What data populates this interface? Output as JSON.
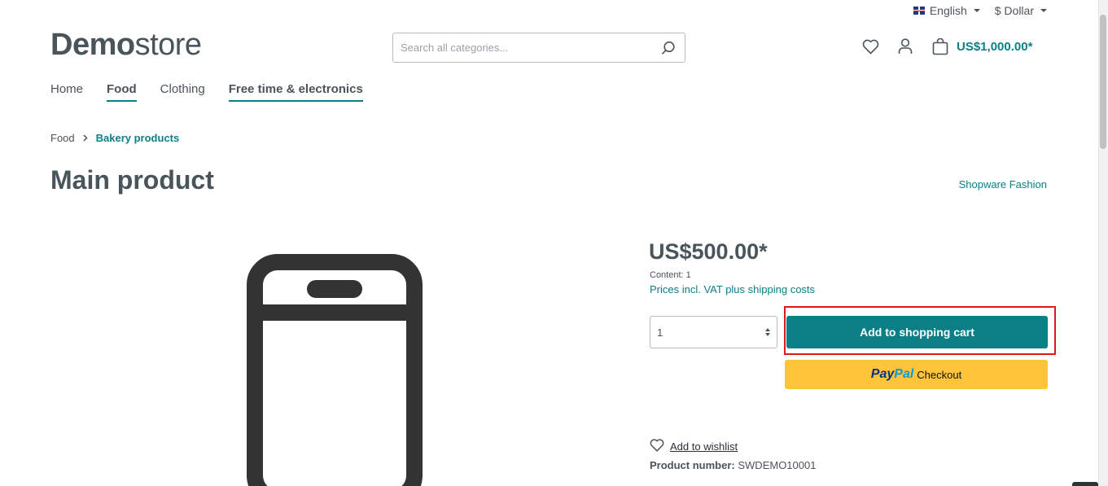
{
  "topbar": {
    "language": "English",
    "currency": "$ Dollar"
  },
  "logo": {
    "bold": "Demo",
    "light": "store"
  },
  "search": {
    "placeholder": "Search all categories..."
  },
  "header": {
    "cart_total": "US$1,000.00*"
  },
  "nav": {
    "items": [
      {
        "label": "Home"
      },
      {
        "label": "Food"
      },
      {
        "label": "Clothing"
      },
      {
        "label": "Free time & electronics"
      }
    ]
  },
  "breadcrumb": {
    "items": [
      {
        "label": "Food"
      },
      {
        "label": "Bakery products"
      }
    ]
  },
  "product": {
    "title": "Main product",
    "manufacturer": "Shopware Fashion",
    "price": "US$500.00*",
    "content": "Content: 1",
    "tax_note": "Prices incl. VAT plus shipping costs",
    "quantity": "1",
    "add_to_cart_label": "Add to shopping cart",
    "paypal": {
      "pay": "Pay",
      "pal": "Pal",
      "label": "Checkout"
    },
    "wishlist_label": "Add to wishlist",
    "number_label": "Product number:",
    "number_value": "SWDEMO10001"
  },
  "colors": {
    "accent": "#0b7f86",
    "text": "#4a545b",
    "paypal": "#ffc439",
    "highlight": "#e0181e"
  }
}
